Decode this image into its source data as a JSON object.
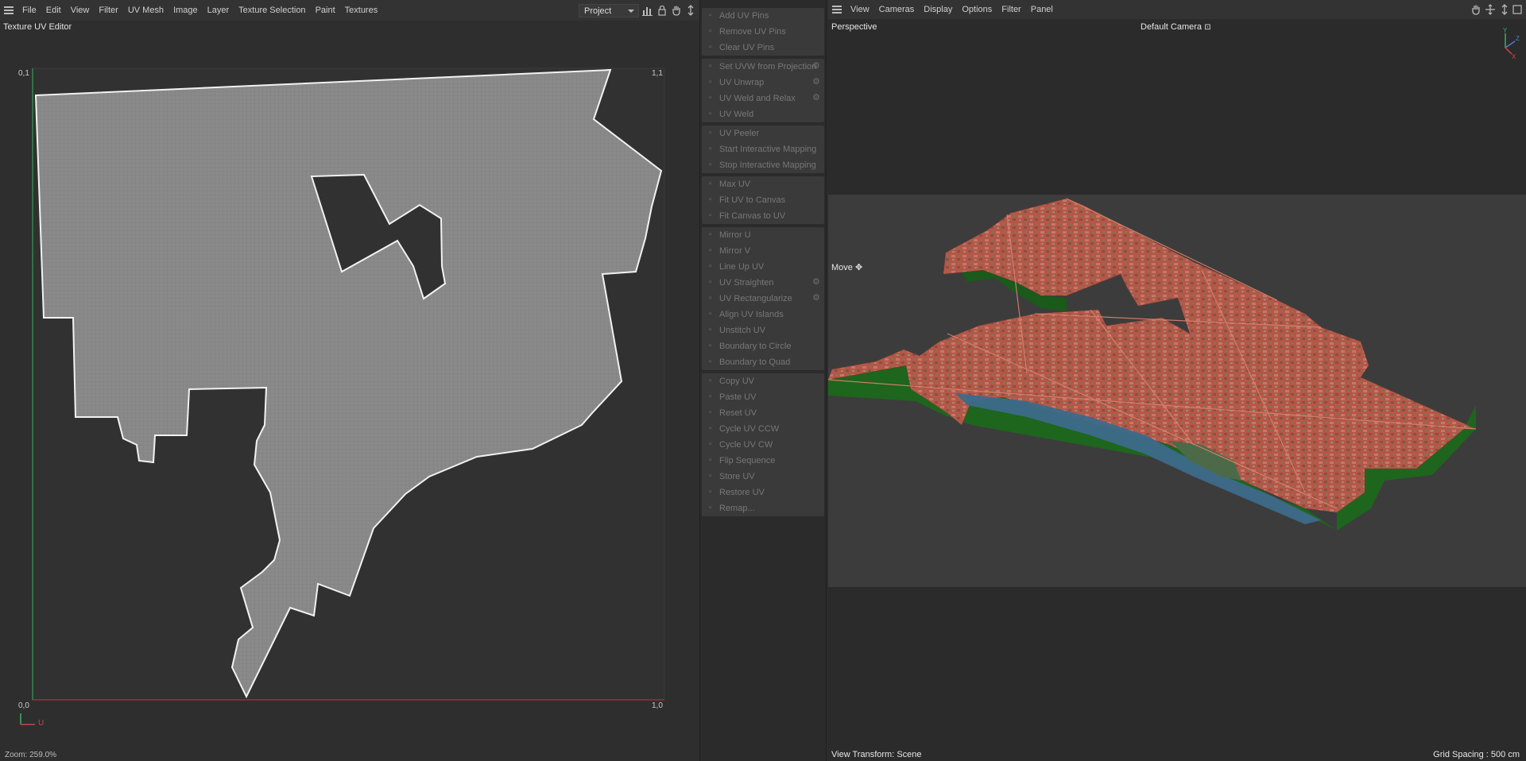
{
  "uv_editor": {
    "menu": [
      "File",
      "Edit",
      "View",
      "Filter",
      "UV Mesh",
      "Image",
      "Layer",
      "Texture Selection",
      "Paint",
      "Textures"
    ],
    "mode_select": "Project",
    "title": "Texture UV Editor",
    "corner_labels": {
      "top_left": "0,1",
      "top_right": "1,1",
      "bottom_left": "0,0",
      "bottom_right": "1,0"
    },
    "axis_label": "U",
    "zoom": "Zoom: 259.0%",
    "icons": [
      "chart-icon",
      "lock-icon",
      "hand-icon",
      "move-arrow-icon"
    ]
  },
  "commands": {
    "groups": [
      [
        {
          "label": "Add UV Pins",
          "icon": "pin-add-icon",
          "gear": false
        },
        {
          "label": "Remove UV Pins",
          "icon": "pin-remove-icon",
          "gear": false
        },
        {
          "label": "Clear UV Pins",
          "icon": "clear-icon",
          "gear": false
        }
      ],
      [
        {
          "label": "Set UVW from Projection",
          "icon": "projection-icon",
          "gear": true
        },
        {
          "label": "UV Unwrap",
          "icon": "unwrap-icon",
          "gear": true
        },
        {
          "label": "UV Weld and Relax",
          "icon": "weld-relax-icon",
          "gear": true
        },
        {
          "label": "UV Weld",
          "icon": "weld-icon",
          "gear": false
        }
      ],
      [
        {
          "label": "UV Peeler",
          "icon": "peeler-icon",
          "gear": false
        },
        {
          "label": "Start Interactive Mapping",
          "icon": "play-icon",
          "gear": false
        },
        {
          "label": "Stop Interactive Mapping",
          "icon": "stop-icon",
          "gear": false
        }
      ],
      [
        {
          "label": "Max UV",
          "icon": "max-icon",
          "gear": false
        },
        {
          "label": "Fit UV to Canvas",
          "icon": "fit-icon",
          "gear": false
        },
        {
          "label": "Fit Canvas to UV",
          "icon": "fit-canvas-icon",
          "gear": false
        }
      ],
      [
        {
          "label": "Mirror U",
          "icon": "mirror-u-icon",
          "gear": false
        },
        {
          "label": "Mirror V",
          "icon": "mirror-v-icon",
          "gear": false
        },
        {
          "label": "Line Up UV",
          "icon": "line-up-icon",
          "gear": false
        },
        {
          "label": "UV Straighten",
          "icon": "straighten-icon",
          "gear": true
        },
        {
          "label": "UV Rectangularize",
          "icon": "rectangularize-icon",
          "gear": true
        },
        {
          "label": "Align UV Islands",
          "icon": "align-icon",
          "gear": false
        },
        {
          "label": "Unstitch UV",
          "icon": "unstitch-icon",
          "gear": false
        },
        {
          "label": "Boundary to Circle",
          "icon": "circle-icon",
          "gear": false
        },
        {
          "label": "Boundary to Quad",
          "icon": "quad-icon",
          "gear": false
        }
      ],
      [
        {
          "label": "Copy UV",
          "icon": "copy-icon",
          "gear": false
        },
        {
          "label": "Paste UV",
          "icon": "paste-icon",
          "gear": false
        },
        {
          "label": "Reset UV",
          "icon": "reset-icon",
          "gear": false
        },
        {
          "label": "Cycle UV CCW",
          "icon": "cycle-ccw-icon",
          "gear": false
        },
        {
          "label": "Cycle UV CW",
          "icon": "cycle-cw-icon",
          "gear": false
        },
        {
          "label": "Flip Sequence",
          "icon": "flip-icon",
          "gear": false
        },
        {
          "label": "Store UV",
          "icon": "store-icon",
          "gear": false
        },
        {
          "label": "Restore UV",
          "icon": "restore-icon",
          "gear": false
        },
        {
          "label": "Remap...",
          "icon": "remap-icon",
          "gear": false
        }
      ]
    ]
  },
  "viewport": {
    "menu": [
      "View",
      "Cameras",
      "Display",
      "Options",
      "Filter",
      "Panel"
    ],
    "view_name": "Perspective",
    "camera": "Default Camera",
    "tool": "Move",
    "axis_labels": {
      "y": "Y",
      "z": "Z",
      "x": "X"
    },
    "footer_left": "View Transform: Scene",
    "footer_right": "Grid Spacing : 500 cm",
    "colors": {
      "extrusion": "#1f6a1f",
      "terrain": "#b85a4a",
      "water": "#3d6a8a"
    }
  }
}
